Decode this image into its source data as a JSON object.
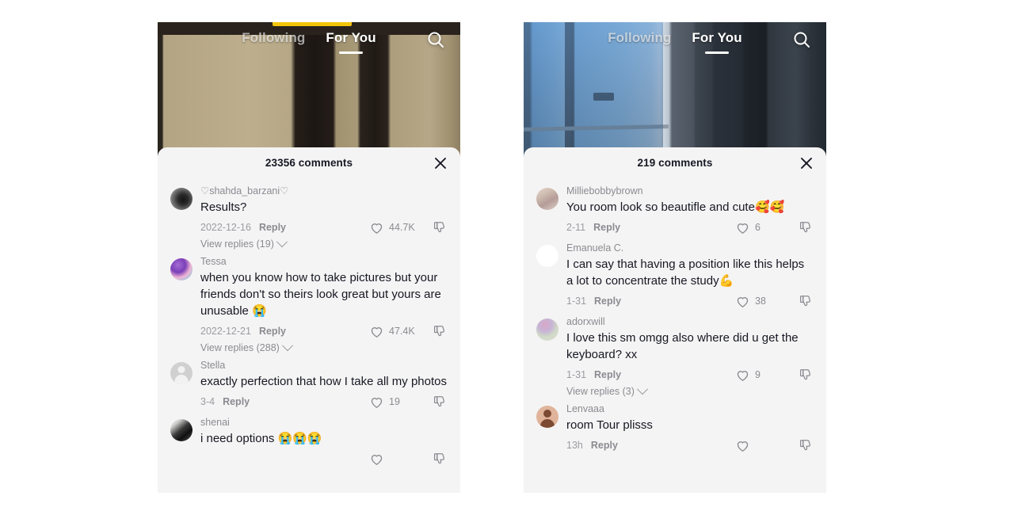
{
  "app": "TikTok comments screenshot comparison",
  "colors": {
    "sheet_bg": "#f5f4f4",
    "text_primary": "#161823",
    "text_secondary": "#8a8b91",
    "accent_badge": "#f3c50a"
  },
  "panels": [
    {
      "id": "left",
      "nav": {
        "following_label": "Following",
        "for_you_label": "For You",
        "search_icon": "search-icon",
        "active_tab": "For You"
      },
      "sheet": {
        "title": "23356 comments",
        "close_icon": "close-icon"
      },
      "comments": [
        {
          "username": "♡shahda_barzani♡",
          "text": "Results?",
          "date": "2022-12-16",
          "reply_label": "Reply",
          "likes": "44.7K",
          "replies_label": "View replies (19)",
          "avatar_style": "ph-photo-dark"
        },
        {
          "username": "Tessa",
          "text": "when you know how to take pictures but your friends don't so theirs look great but yours are unusable 😭",
          "date": "2022-12-21",
          "reply_label": "Reply",
          "likes": "47.4K",
          "replies_label": "View replies (288)",
          "avatar_style": "ph-photo-purple"
        },
        {
          "username": "Stella",
          "text": "exactly perfection that how I take all my photos",
          "date": "3-4",
          "reply_label": "Reply",
          "likes": "19",
          "replies_label": "",
          "avatar_style": "ph-person"
        },
        {
          "username": "shenai",
          "text": "i need options 😭😭😭",
          "date": "",
          "reply_label": "",
          "likes": "",
          "replies_label": "",
          "avatar_style": "ph-photo-gray"
        }
      ]
    },
    {
      "id": "right",
      "nav": {
        "following_label": "Following",
        "for_you_label": "For You",
        "search_icon": "search-icon",
        "active_tab": "For You"
      },
      "sheet": {
        "title": "219 comments",
        "close_icon": "close-icon"
      },
      "comments": [
        {
          "username": "Milliebobbybrown",
          "text": "You room look so beautifle and cute🥰🥰",
          "date": "2-11",
          "reply_label": "Reply",
          "likes": "6",
          "replies_label": "",
          "avatar_style": "ph-photo-pink"
        },
        {
          "username": "Emanuela C.",
          "text": "I can say that having a position like this helps a lot to concentrate the study💪",
          "date": "1-31",
          "reply_label": "Reply",
          "likes": "38",
          "replies_label": "",
          "avatar_style": "ph-blank"
        },
        {
          "username": "adorxwill",
          "text": "I love this sm omgg also where did u get the keyboard? xx",
          "date": "1-31",
          "reply_label": "Reply",
          "likes": "9",
          "replies_label": "View replies (3)",
          "avatar_style": "ph-photo-floral"
        },
        {
          "username": "Lenvaaa",
          "text": "room Tour plisss",
          "date": "13h",
          "reply_label": "Reply",
          "likes": "",
          "replies_label": "",
          "avatar_style": "ph-brown"
        }
      ]
    }
  ]
}
